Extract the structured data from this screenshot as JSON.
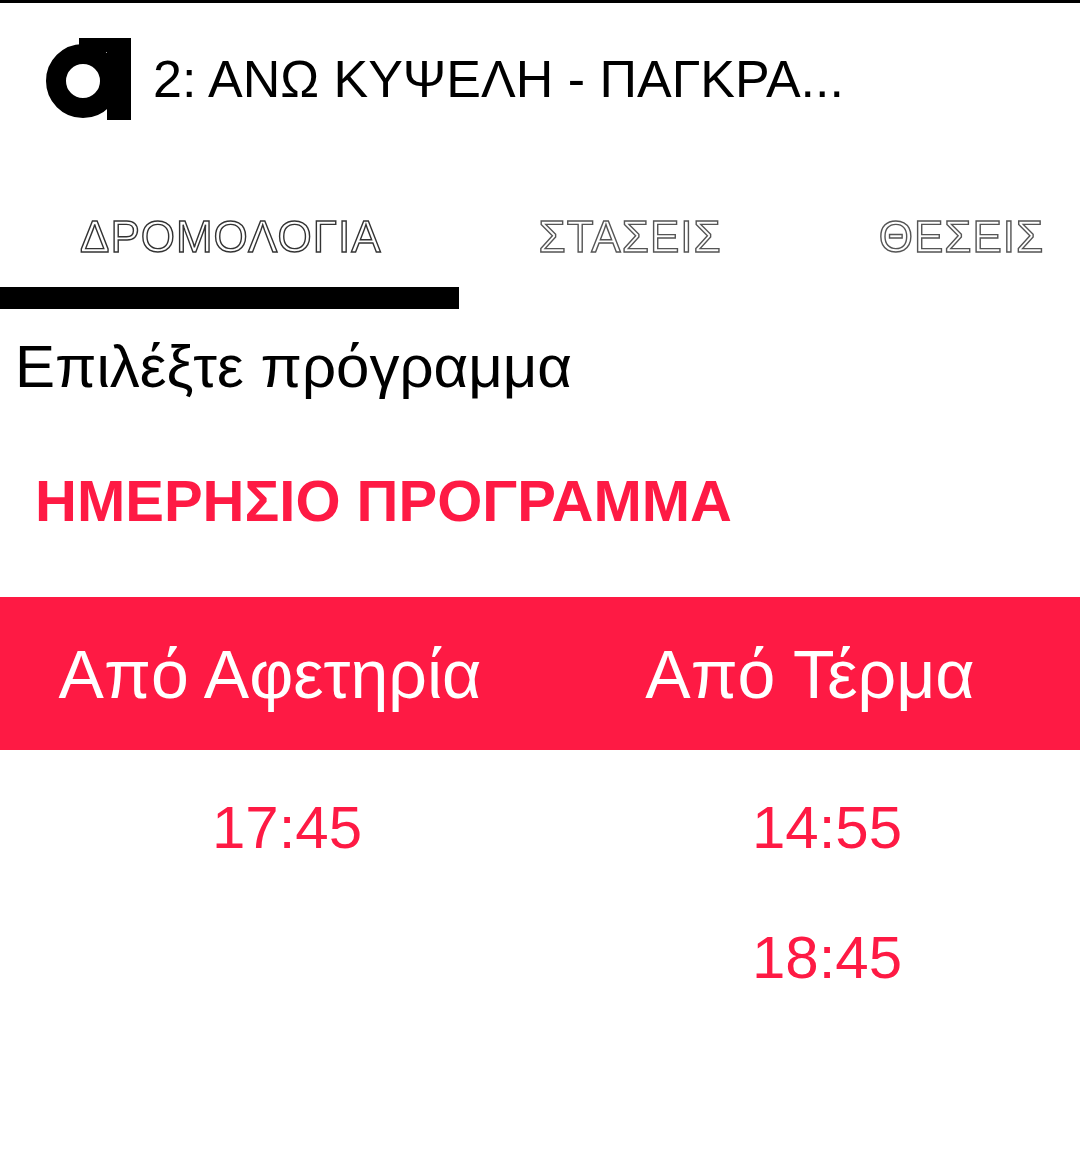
{
  "app_bar": {
    "title": "2: ΑΝΩ ΚΥΨΕΛΗ - ΠΑΓΚΡΑ..."
  },
  "tabs": [
    {
      "label": "ΔΡΟΜΟΛΟΓΙΑ",
      "selected": true
    },
    {
      "label": "ΣΤΑΣΕΙΣ",
      "selected": false
    },
    {
      "label": "ΘΕΣΕΙΣ",
      "selected": false
    }
  ],
  "prompt": "Επιλέξτε πρόγραμμα",
  "schedule": {
    "title": "ΗΜΕΡΗΣΙΟ ΠΡΟΓΡΑΜΜΑ",
    "columns": [
      {
        "header": "Από Αφετηρία",
        "times": [
          "17:45"
        ]
      },
      {
        "header": "Από Τέρμα",
        "times": [
          "14:55",
          "18:45"
        ]
      }
    ]
  }
}
